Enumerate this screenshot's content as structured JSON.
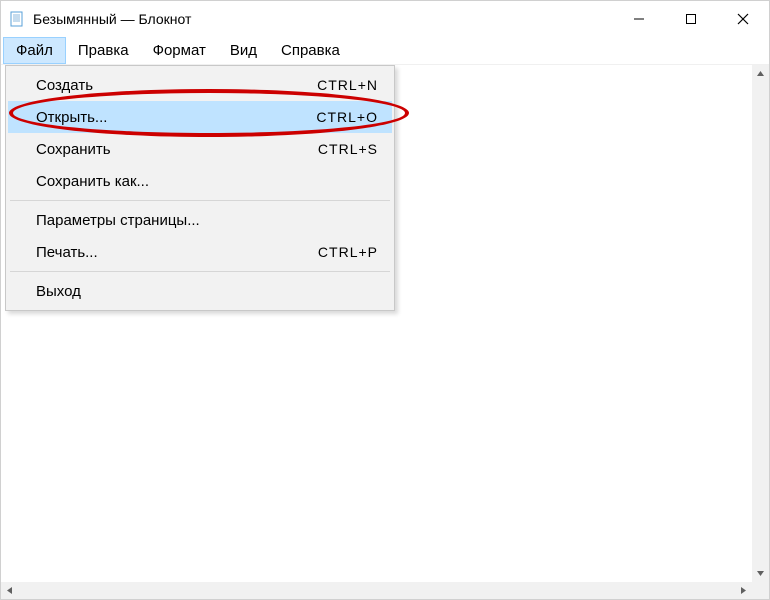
{
  "titlebar": {
    "title": "Безымянный — Блокнот"
  },
  "menubar": {
    "items": [
      {
        "label": "Файл",
        "active": true
      },
      {
        "label": "Правка",
        "active": false
      },
      {
        "label": "Формат",
        "active": false
      },
      {
        "label": "Вид",
        "active": false
      },
      {
        "label": "Справка",
        "active": false
      }
    ]
  },
  "dropdown": {
    "items": [
      {
        "label": "Создать",
        "shortcut": "CTRL+N",
        "highlight": false
      },
      {
        "label": "Открыть...",
        "shortcut": "CTRL+O",
        "highlight": true
      },
      {
        "label": "Сохранить",
        "shortcut": "CTRL+S",
        "highlight": false
      },
      {
        "label": "Сохранить как...",
        "shortcut": "",
        "highlight": false
      },
      {
        "sep": true
      },
      {
        "label": "Параметры страницы...",
        "shortcut": "",
        "highlight": false
      },
      {
        "label": "Печать...",
        "shortcut": "CTRL+P",
        "highlight": false
      },
      {
        "sep": true
      },
      {
        "label": "Выход",
        "shortcut": "",
        "highlight": false
      }
    ]
  }
}
